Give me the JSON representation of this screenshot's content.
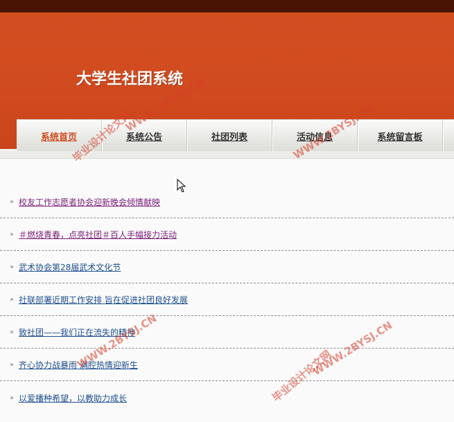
{
  "site": {
    "title": "大学生社团系统"
  },
  "nav": {
    "items": [
      {
        "label": "系统首页",
        "active": true
      },
      {
        "label": "系统公告",
        "active": false
      },
      {
        "label": "社团列表",
        "active": false
      },
      {
        "label": "活动信息",
        "active": false
      },
      {
        "label": "系统留言板",
        "active": false
      }
    ]
  },
  "news": {
    "bullet": "»",
    "items": [
      {
        "title": "校友工作志愿者协会迎新晚会倾情献映",
        "visited": true
      },
      {
        "title": "＃燃烧青春，点亮社团＃百人手幅接力活动",
        "visited": true
      },
      {
        "title": "武术协会第28届武术文化节",
        "visited": false
      },
      {
        "title": "社联部署近期工作安排 旨在促进社团良好发展",
        "visited": false
      },
      {
        "title": "致社团——我们正在流失的精神",
        "visited": false
      },
      {
        "title": "齐心协力战暴雨 满腔热情迎新生",
        "visited": false
      },
      {
        "title": "以爱播种希望，以教助力成长",
        "visited": false
      }
    ]
  },
  "watermarks": {
    "url": "WWW.2BYSJ.CN",
    "cn": "毕业设计论文网"
  },
  "colors": {
    "header": "#d24f22",
    "topbar": "#4a1403",
    "nav_active": "#d04a1e",
    "link": "#1f4f8f",
    "visited": "#7a1f7a"
  }
}
